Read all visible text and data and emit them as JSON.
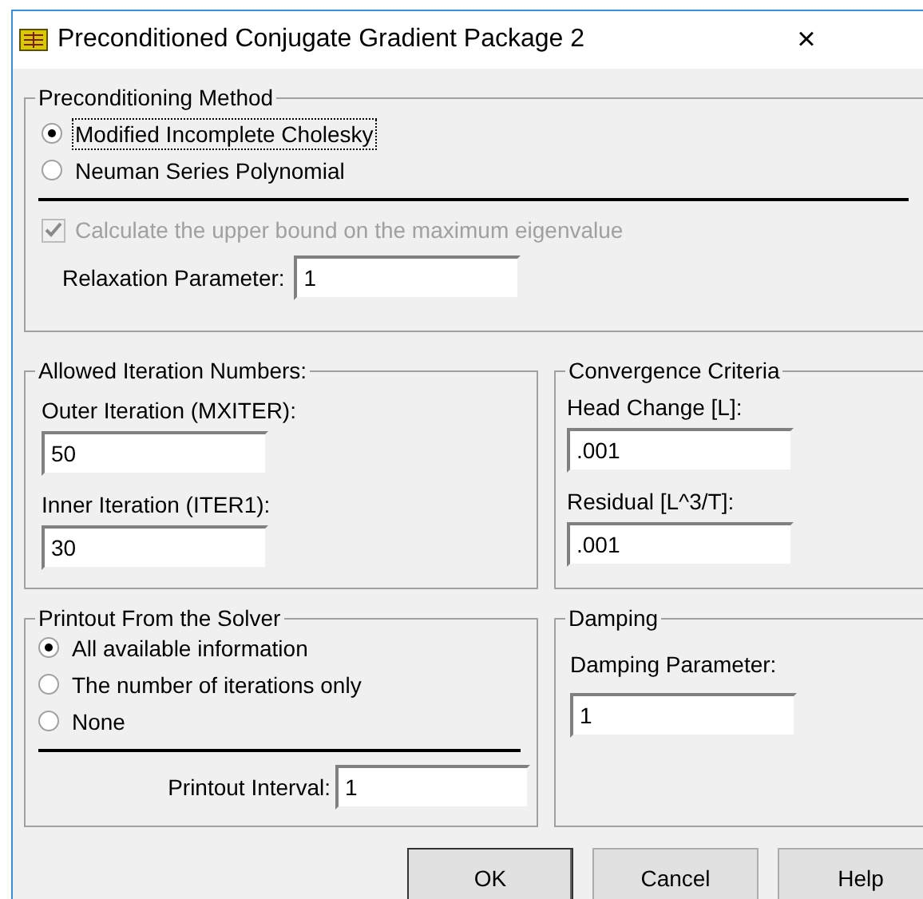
{
  "window": {
    "title": "Preconditioned Conjugate Gradient Package 2",
    "close": "×"
  },
  "preconditioning": {
    "title": "Preconditioning Method",
    "options": [
      {
        "label": "Modified Incomplete Cholesky",
        "selected": true,
        "focused": true
      },
      {
        "label": "Neuman Series Polynomial",
        "selected": false,
        "focused": false
      }
    ],
    "eigen_checkbox": {
      "label": "Calculate the upper bound on the maximum eigenvalue",
      "checked": true,
      "disabled": true
    },
    "relaxation": {
      "label": "Relaxation Parameter:",
      "value": "1"
    }
  },
  "iterations": {
    "title": "Allowed Iteration Numbers:",
    "fields": [
      {
        "label": "Outer Iteration (MXITER):",
        "value": "50"
      },
      {
        "label": "Inner Iteration (ITER1):",
        "value": "30"
      }
    ]
  },
  "convergence": {
    "title": "Convergence Criteria",
    "fields": [
      {
        "label": "Head Change [L]:",
        "value": ".001"
      },
      {
        "label": "Residual [L^3/T]:",
        "value": ".001"
      }
    ]
  },
  "printout": {
    "title": "Printout From the Solver",
    "options": [
      {
        "label": "All available information",
        "selected": true
      },
      {
        "label": "The number of iterations only",
        "selected": false
      },
      {
        "label": "None",
        "selected": false
      }
    ],
    "interval": {
      "label": "Printout Interval:",
      "value": "1"
    }
  },
  "damping": {
    "title": "Damping",
    "field": {
      "label": "Damping Parameter:",
      "value": "1"
    }
  },
  "buttons": [
    "OK",
    "Cancel",
    "Help"
  ]
}
